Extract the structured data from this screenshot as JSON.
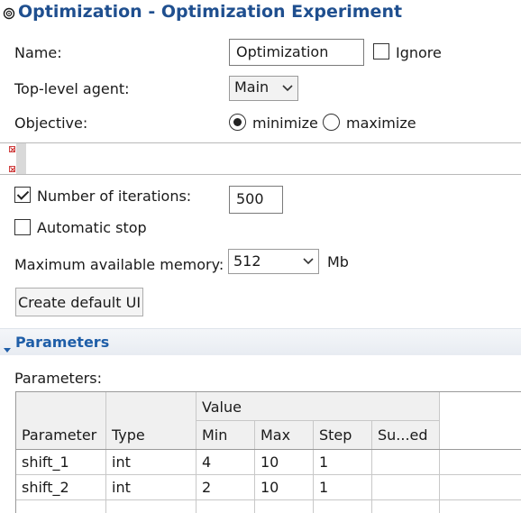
{
  "title": "Optimization - Optimization Experiment",
  "form": {
    "name_label": "Name:",
    "name_value": "Optimization",
    "ignore_label": "Ignore",
    "ignore_checked": false,
    "top_agent_label": "Top-level agent:",
    "top_agent_value": "Main",
    "objective_label": "Objective:",
    "objective_options": [
      "minimize",
      "maximize"
    ],
    "objective_selected": "minimize",
    "iterations_label": "Number of iterations:",
    "iterations_checked": true,
    "iterations_value": "500",
    "autostop_label": "Automatic stop",
    "autostop_checked": false,
    "memory_label": "Maximum available memory:",
    "memory_value": "512",
    "memory_unit": "Mb",
    "create_ui_label": "Create default UI"
  },
  "parameters_section": {
    "title": "Parameters",
    "table_label": "Parameters:",
    "group_header": "Value",
    "columns": [
      "Parameter",
      "Type",
      "Min",
      "Max",
      "Step",
      "Su...ed"
    ],
    "rows": [
      [
        "shift_1",
        "int",
        "4",
        "10",
        "1",
        ""
      ],
      [
        "shift_2",
        "int",
        "2",
        "10",
        "1",
        ""
      ]
    ]
  },
  "colors": {
    "title": "#1f4f8f",
    "section_title": "#1f5ea8",
    "error_marker": "#d04040"
  },
  "icons": [
    "optimization-experiment-icon",
    "chevron-down-icon",
    "error-marker-icon",
    "section-collapse-icon"
  ]
}
